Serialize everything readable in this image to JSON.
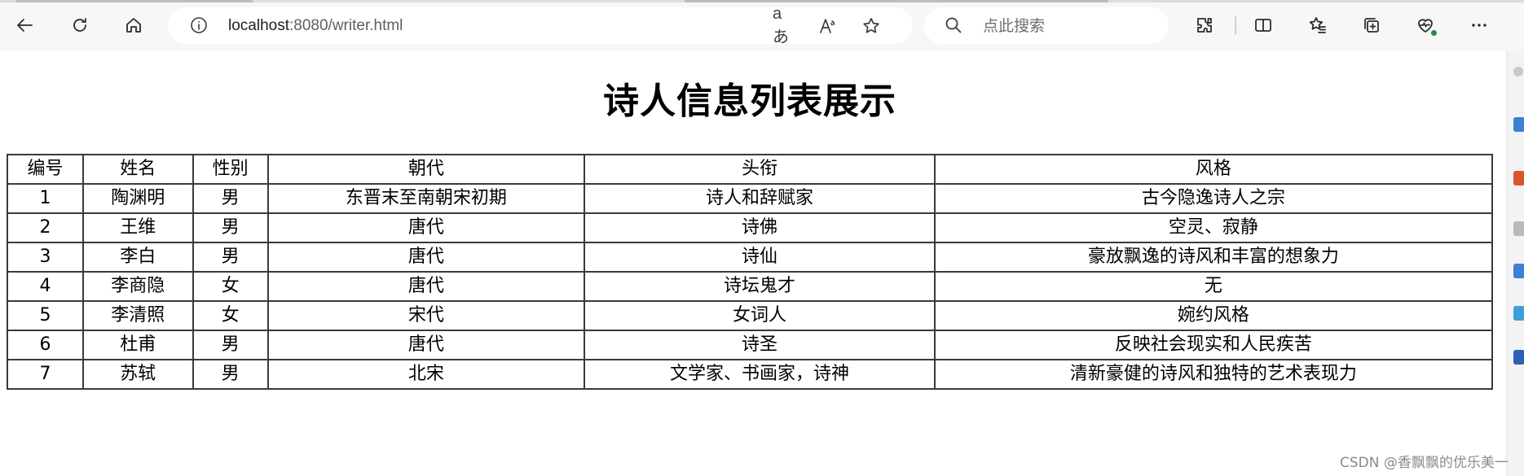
{
  "browser": {
    "url_host": "localhost",
    "url_path": ":8080/writer.html",
    "search_placeholder": "点此搜索",
    "read_mode_label": "aあ",
    "read_aloud_label": "A"
  },
  "page": {
    "title": "诗人信息列表展示"
  },
  "table": {
    "headers": [
      "编号",
      "姓名",
      "性别",
      "朝代",
      "头衔",
      "风格"
    ],
    "rows": [
      [
        "1",
        "陶渊明",
        "男",
        "东晋末至南朝宋初期",
        "诗人和辞赋家",
        "古今隐逸诗人之宗"
      ],
      [
        "2",
        "王维",
        "男",
        "唐代",
        "诗佛",
        "空灵、寂静"
      ],
      [
        "3",
        "李白",
        "男",
        "唐代",
        "诗仙",
        "豪放飘逸的诗风和丰富的想象力"
      ],
      [
        "4",
        "李商隐",
        "女",
        "唐代",
        "诗坛鬼才",
        "无"
      ],
      [
        "5",
        "李清照",
        "女",
        "宋代",
        "女词人",
        "婉约风格"
      ],
      [
        "6",
        "杜甫",
        "男",
        "唐代",
        "诗圣",
        "反映社会现实和人民疾苦"
      ],
      [
        "7",
        "苏轼",
        "男",
        "北宋",
        "文学家、书画家，诗神",
        "清新豪健的诗风和独特的艺术表现力"
      ]
    ]
  },
  "watermark": "CSDN @香飘飘的优乐美一",
  "colors": {
    "toolbar_bg": "#f7f7f7",
    "border": "#3a3a3a",
    "rail_accents": [
      "#c8c8c8",
      "#3f7fd6",
      "#d9552b",
      "#b9b9b9",
      "#3f7fd6",
      "#3f9fd6",
      "#2f5fb6"
    ]
  }
}
